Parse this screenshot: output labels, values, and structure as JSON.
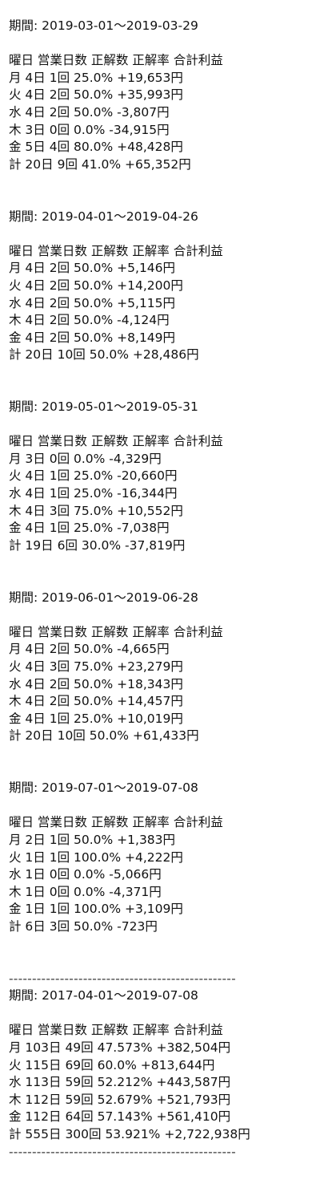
{
  "header_row": "曜日 営業日数 正解数 正解率 合計利益",
  "period_label": "期間: ",
  "separator": "-------------------------------------------------",
  "blocks": [
    {
      "period": "2019-03-01〜2019-03-29",
      "rows": [
        "月 4日 1回 25.0% +19,653円",
        "火 4日 2回 50.0% +35,993円",
        "水 4日 2回 50.0% -3,807円",
        "木 3日 0回 0.0% -34,915円",
        "金 5日 4回 80.0% +48,428円",
        "計 20日 9回 41.0% +65,352円"
      ]
    },
    {
      "period": "2019-04-01〜2019-04-26",
      "rows": [
        "月 4日 2回 50.0% +5,146円",
        "火 4日 2回 50.0% +14,200円",
        "水 4日 2回 50.0% +5,115円",
        "木 4日 2回 50.0% -4,124円",
        "金 4日 2回 50.0% +8,149円",
        "計 20日 10回 50.0% +28,486円"
      ]
    },
    {
      "period": "2019-05-01〜2019-05-31",
      "rows": [
        "月 3日 0回 0.0% -4,329円",
        "火 4日 1回 25.0% -20,660円",
        "水 4日 1回 25.0% -16,344円",
        "木 4日 3回 75.0% +10,552円",
        "金 4日 1回 25.0% -7,038円",
        "計 19日 6回 30.0% -37,819円"
      ]
    },
    {
      "period": "2019-06-01〜2019-06-28",
      "rows": [
        "月 4日 2回 50.0% -4,665円",
        "火 4日 3回 75.0% +23,279円",
        "水 4日 2回 50.0% +18,343円",
        "木 4日 2回 50.0% +14,457円",
        "金 4日 1回 25.0% +10,019円",
        "計 20日 10回 50.0% +61,433円"
      ]
    },
    {
      "period": "2019-07-01〜2019-07-08",
      "rows": [
        "月 2日 1回 50.0% +1,383円",
        "火 1日 1回 100.0% +4,222円",
        "水 1日 0回 0.0% -5,066円",
        "木 1日 0回 0.0% -4,371円",
        "金 1日 1回 100.0% +3,109円",
        "計 6日 3回 50.0% -723円"
      ]
    }
  ],
  "summary": {
    "period": "2017-04-01〜2019-07-08",
    "rows": [
      "月 103日 49回 47.573% +382,504円",
      "火 115日 69回 60.0% +813,644円",
      "水 113日 59回 52.212% +443,587円",
      "木 112日 59回 52.679% +521,793円",
      "金 112日 64回 57.143% +561,410円",
      "計 555日 300回 53.921% +2,722,938円"
    ]
  }
}
